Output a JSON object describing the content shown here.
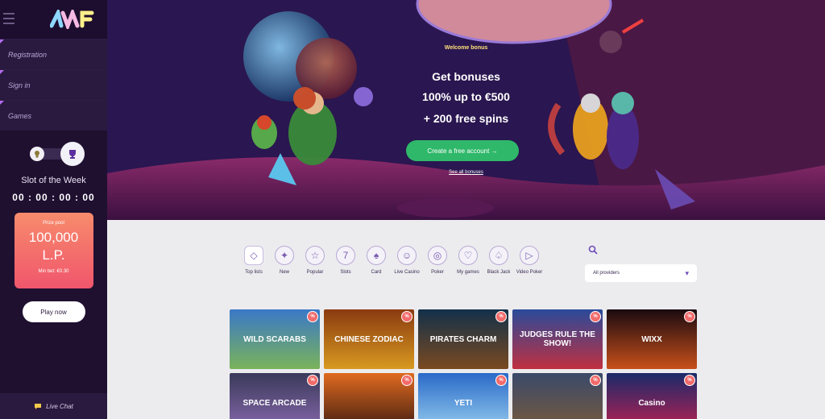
{
  "sidebar": {
    "nav": [
      {
        "label": "Registration"
      },
      {
        "label": "Sign in"
      },
      {
        "label": "Games"
      }
    ],
    "slot_week": {
      "title": "Slot of the Week",
      "timer": "00 : 00 : 00 : 00",
      "prize_label": "Prize pool",
      "prize_amount": "100,000\nL.P.",
      "min_bet": "Min bet: €0.30",
      "play_label": "Play now"
    },
    "live_chat": "Live Chat"
  },
  "hero": {
    "welcome": "Welcome bonus",
    "line1": "Get bonuses",
    "line2": "100% up to €500",
    "line3": "+ 200 free spins",
    "cta": "Create a free account →",
    "see_all": "See all bonuses"
  },
  "categories": [
    {
      "label": "Top lists",
      "icon": "diamond-icon",
      "glyph": "◇"
    },
    {
      "label": "New",
      "icon": "new-icon",
      "glyph": "✦"
    },
    {
      "label": "Popular",
      "icon": "star-icon",
      "glyph": "☆"
    },
    {
      "label": "Slots",
      "icon": "slots-icon",
      "glyph": "7"
    },
    {
      "label": "Card",
      "icon": "card-icon",
      "glyph": "♠"
    },
    {
      "label": "Live Casino",
      "icon": "dealer-icon",
      "glyph": "☺"
    },
    {
      "label": "Poker",
      "icon": "chip-icon",
      "glyph": "◎"
    },
    {
      "label": "My games",
      "icon": "heart-icon",
      "glyph": "♡"
    },
    {
      "label": "Black Jack",
      "icon": "spade-icon",
      "glyph": "♤"
    },
    {
      "label": "Video Poker",
      "icon": "play-icon",
      "glyph": "▷"
    }
  ],
  "providers": {
    "selected": "All providers"
  },
  "games": [
    {
      "title": "WILD SCARABS",
      "bg": "linear-gradient(180deg,#3a78c8,#7ab35a)"
    },
    {
      "title": "CHINESE ZODIAC",
      "bg": "linear-gradient(180deg,#8a3a10,#d89a20)"
    },
    {
      "title": "PIRATES CHARM",
      "bg": "linear-gradient(180deg,#12304a,#7a4a20)"
    },
    {
      "title": "JUDGES RULE THE SHOW!",
      "bg": "linear-gradient(180deg,#2a4a9a,#c03040)"
    },
    {
      "title": "WIXX",
      "bg": "linear-gradient(180deg,#1a0a10,#c8501a)"
    },
    {
      "title": "SPACE ARCADE",
      "bg": "linear-gradient(180deg,#3a3a5a,#8a6ab0)"
    },
    {
      "title": "",
      "bg": "linear-gradient(180deg,#e06a20,#3a1a10)"
    },
    {
      "title": "YETI",
      "bg": "linear-gradient(180deg,#2a6ac8,#9ad0f0)"
    },
    {
      "title": "",
      "bg": "linear-gradient(180deg,#3a4a6a,#7a5a3a)"
    },
    {
      "title": "Casino",
      "bg": "linear-gradient(180deg,#1a2a6a,#c02050)"
    }
  ]
}
